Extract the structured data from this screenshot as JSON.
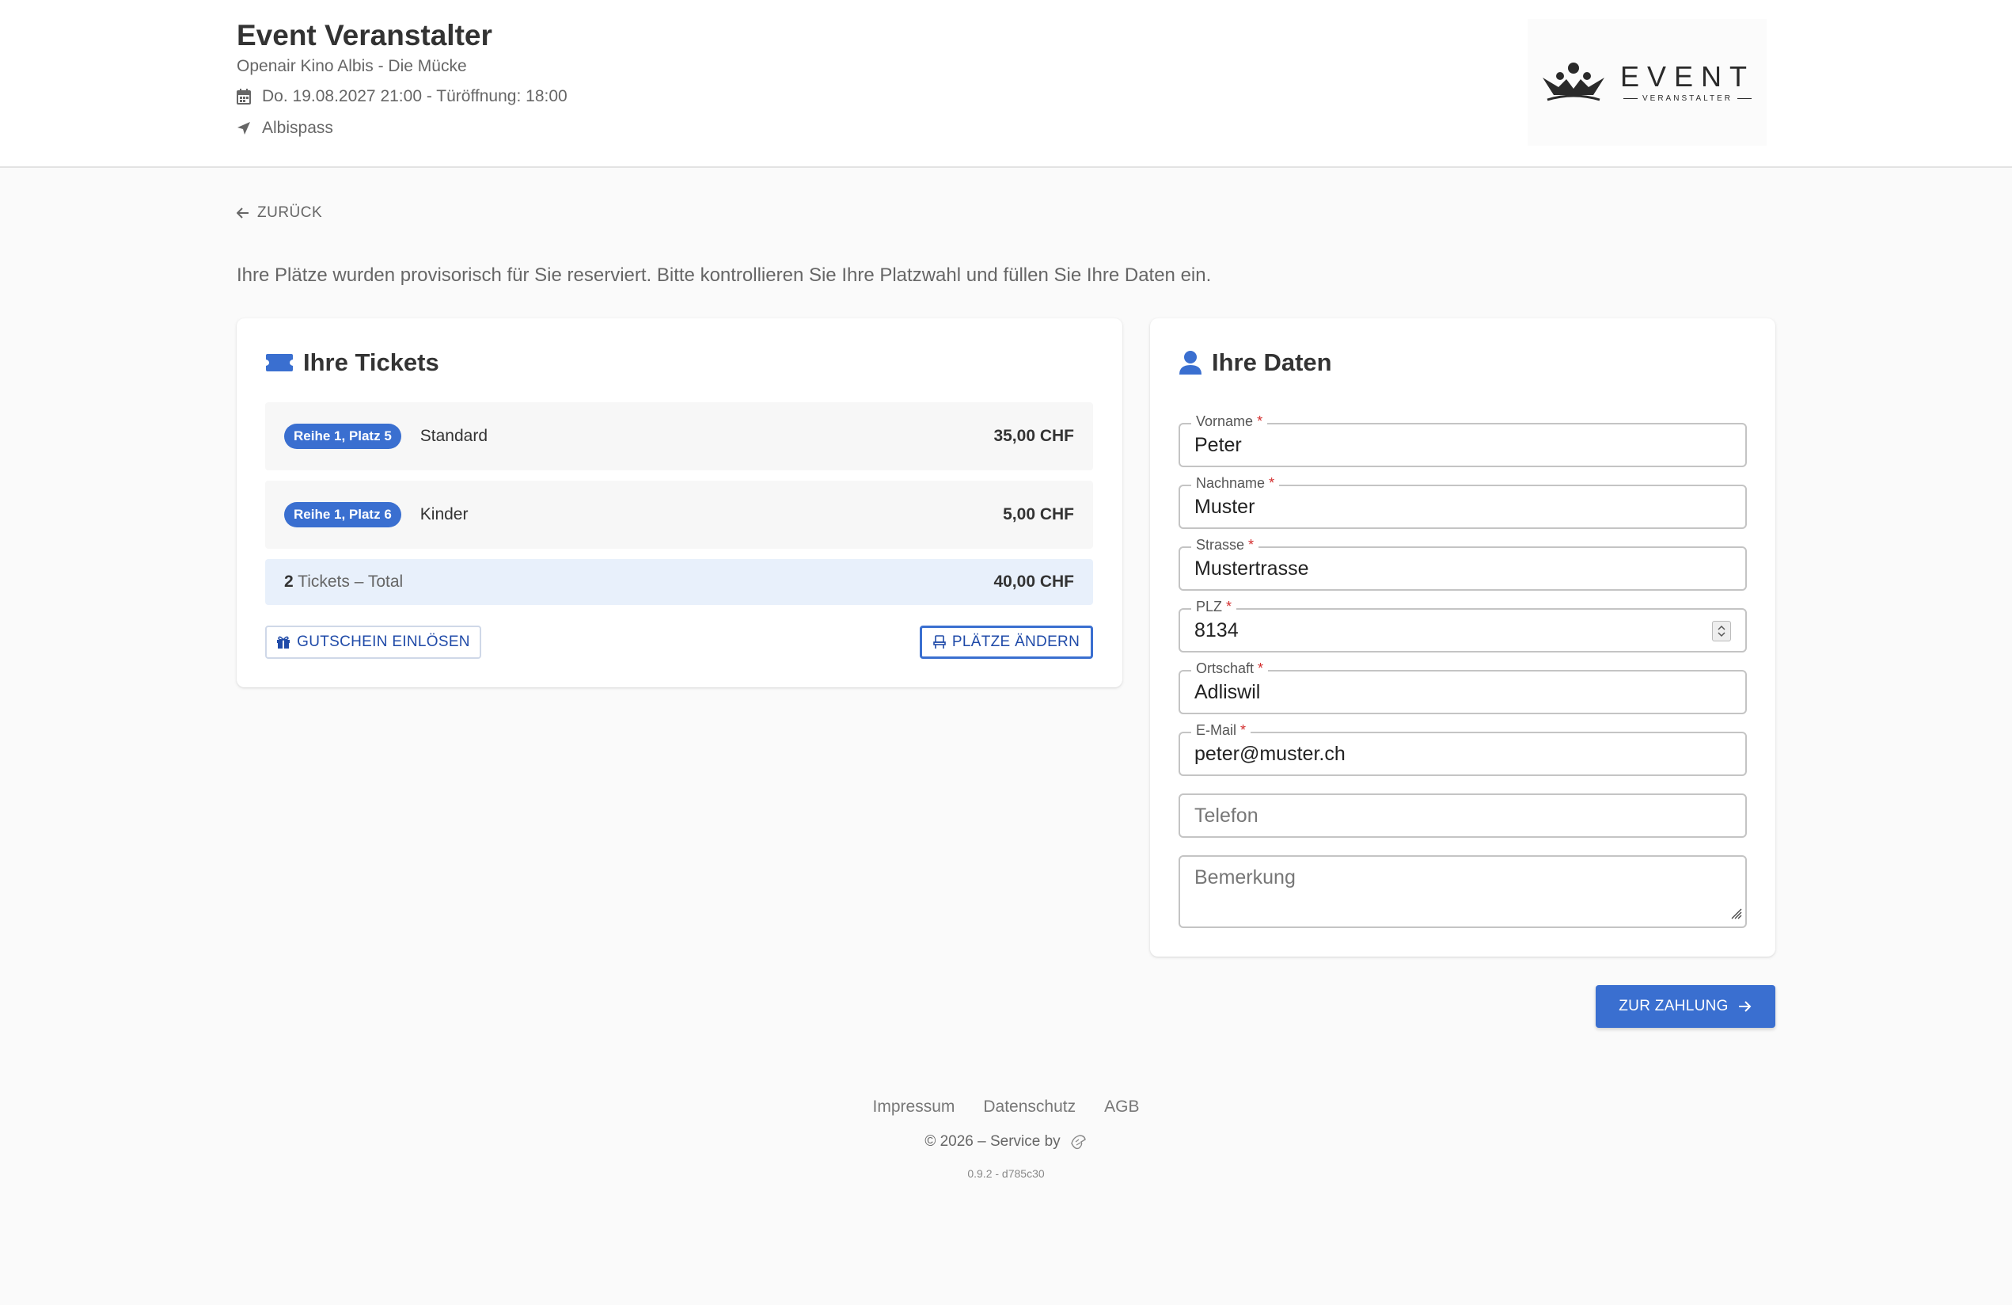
{
  "header": {
    "title": "Event Veranstalter",
    "subtitle": "Openair Kino Albis - Die Mücke",
    "date": "Do. 19.08.2027 21:00 - Türöffnung: 18:00",
    "location": "Albispass",
    "logo_text": "EVENT",
    "logo_subtext": "VERANSTALTER"
  },
  "back_label": "ZURÜCK",
  "intro": "Ihre Plätze wurden provisorisch für Sie reserviert. Bitte kontrollieren Sie Ihre Platzwahl und füllen Sie Ihre Daten ein.",
  "tickets": {
    "title": "Ihre Tickets",
    "items": [
      {
        "seat": "Reihe 1, Platz 5",
        "category": "Standard",
        "price": "35,00 CHF"
      },
      {
        "seat": "Reihe 1, Platz 6",
        "category": "Kinder",
        "price": "5,00 CHF"
      }
    ],
    "total_count": "2",
    "total_label": " Tickets – Total",
    "total_price": "40,00 CHF",
    "voucher_button": "GUTSCHEIN EINLÖSEN",
    "change_seats_button": "PLÄTZE ÄNDERN"
  },
  "form": {
    "title": "Ihre Daten",
    "required_mark": "*",
    "fields": [
      {
        "label": "Vorname",
        "value": "Peter"
      },
      {
        "label": "Nachname",
        "value": "Muster"
      },
      {
        "label": "Strasse",
        "value": "Mustertrasse"
      },
      {
        "label": "PLZ",
        "value": "8134"
      },
      {
        "label": "Ortschaft",
        "value": "Adliswil"
      },
      {
        "label": "E-Mail",
        "value": "peter@muster.ch"
      }
    ],
    "phone_placeholder": "Telefon",
    "remark_placeholder": "Bemerkung"
  },
  "pay_button": "ZUR ZAHLUNG",
  "footer": {
    "links": [
      "Impressum",
      "Datenschutz",
      "AGB"
    ],
    "copyright": "© 2026 – Service by",
    "version": "0.9.2 - d785c30"
  },
  "colors": {
    "accent": "#3a6fd0",
    "total_bg": "#e8f0fb",
    "page_bg": "#fafafa"
  },
  "icons": {
    "date": "calendar-icon",
    "location": "location-arrow-icon",
    "back": "arrow-left-icon",
    "tickets": "ticket-icon",
    "data": "user-icon",
    "voucher": "gift-icon",
    "seats": "chair-icon",
    "pay": "arrow-right-icon"
  }
}
